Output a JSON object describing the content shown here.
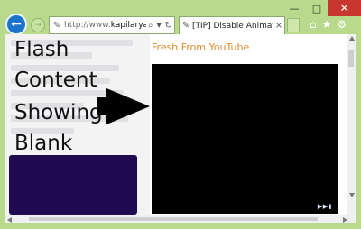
{
  "window": {
    "minimize_glyph": "—",
    "maximize_glyph": "□",
    "close_glyph": "✕"
  },
  "nav": {
    "back_glyph": "←",
    "forward_glyph": "→"
  },
  "address": {
    "url_prefix": "http://www.",
    "url_domain": "kapilarya.",
    "url_ellipsis": "...",
    "search_glyph": "⌕",
    "dropdown_glyph": "▾",
    "refresh_glyph": "↻"
  },
  "tab": {
    "title": "[TIP] Disable Animatio...",
    "close_glyph": "×"
  },
  "toolbar": {
    "home_glyph": "⌂",
    "favorites_glyph": "★",
    "settings_glyph": "⚙"
  },
  "page": {
    "left_lines": [
      "Flash",
      "Content",
      "Showing",
      "Blank"
    ],
    "video_title": "Fresh From YouTube",
    "video_logo": "▶▶▮"
  },
  "colors": {
    "frame": "#b9d98c",
    "back_button": "#1b74c9",
    "video_title": "#e28c2e",
    "purple_block": "#1f0a52"
  }
}
